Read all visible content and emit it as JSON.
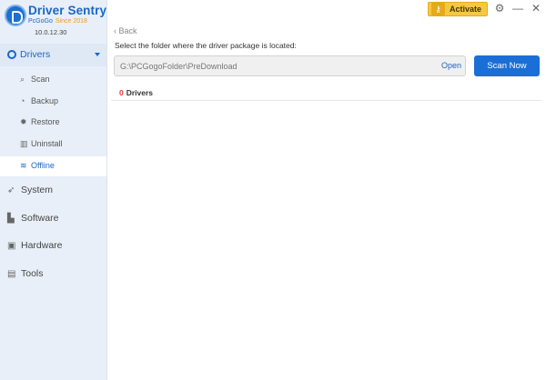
{
  "brand": {
    "name": "Driver Sentry",
    "company": "PcGoGo",
    "since": "Since 2018",
    "version": "10.0.12.30"
  },
  "header": {
    "activate_label": "Activate",
    "icons": [
      "key-icon",
      "settings-icon",
      "minimize-icon",
      "close-icon"
    ]
  },
  "sidebar": {
    "drivers_label": "Drivers",
    "sub_items": [
      {
        "label": "Scan",
        "icon": "scan-icon"
      },
      {
        "label": "Backup",
        "icon": "backup-icon"
      },
      {
        "label": "Restore",
        "icon": "restore-icon"
      },
      {
        "label": "Uninstall",
        "icon": "trash-icon"
      },
      {
        "label": "Offline",
        "icon": "wifi-icon",
        "active": true
      }
    ],
    "items": [
      {
        "label": "System",
        "icon": "rocket-icon"
      },
      {
        "label": "Software",
        "icon": "software-icon"
      },
      {
        "label": "Hardware",
        "icon": "chip-icon"
      },
      {
        "label": "Tools",
        "icon": "toolbox-icon"
      }
    ]
  },
  "main": {
    "back_label": "Back",
    "instruction": "Select the folder where the driver package is located:",
    "path_value": "G:\\PCGogoFolder\\PreDownload",
    "open_label": "Open",
    "scan_now_label": "Scan Now",
    "drivers_count": "0",
    "drivers_label": "Drivers"
  },
  "colors": {
    "accent": "#1a6fd6",
    "sidebar_bg": "#e9eff8",
    "activate_bg": "#f5c842",
    "count_red": "#e23b3b"
  }
}
